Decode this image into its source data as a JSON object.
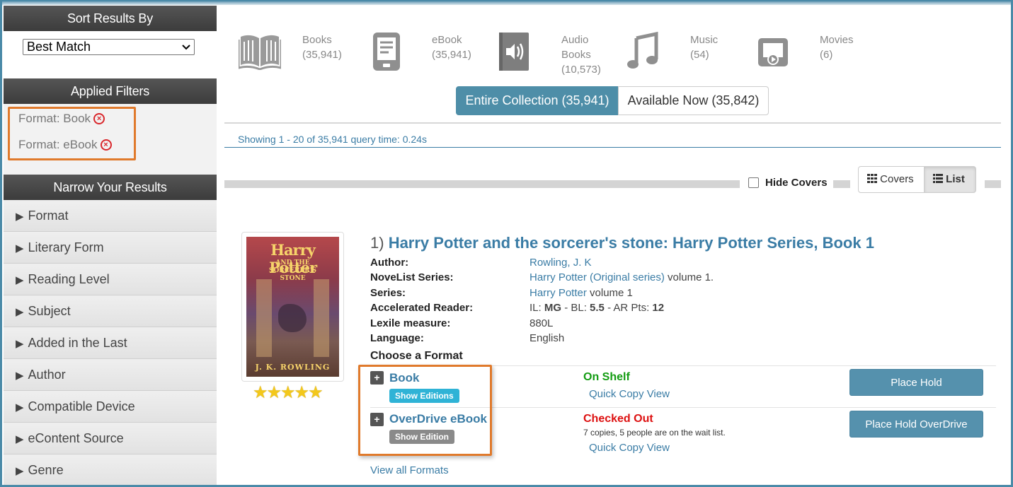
{
  "sidebar": {
    "sort_header": "Sort Results By",
    "sort_value": "Best Match",
    "applied_header": "Applied Filters",
    "applied_filters": [
      "Format: Book",
      "Format: eBook"
    ],
    "narrow_header": "Narrow Your Results",
    "facets": [
      "Format",
      "Literary Form",
      "Reading Level",
      "Subject",
      "Added in the Last",
      "Author",
      "Compatible Device",
      "eContent Source",
      "Genre"
    ]
  },
  "formats": [
    {
      "icon": "book-icon",
      "label_line1": "Books",
      "label_line2": "(35,941)",
      "label_line3": ""
    },
    {
      "icon": "ebook-icon",
      "label_line1": "eBook",
      "label_line2": "(35,941)",
      "label_line3": ""
    },
    {
      "icon": "audiobook-icon",
      "label_line1": "Audio",
      "label_line2": "Books",
      "label_line3": "(10,573)"
    },
    {
      "icon": "music-icon",
      "label_line1": "Music",
      "label_line2": "(54)",
      "label_line3": ""
    },
    {
      "icon": "movie-icon",
      "label_line1": "Movies",
      "label_line2": "(6)",
      "label_line3": ""
    }
  ],
  "availability": {
    "entire": "Entire Collection (35,941)",
    "available": "Available Now (35,842)"
  },
  "showing_text": "Showing 1 - 20 of 35,941 query time: 0.24s",
  "view": {
    "hide_covers": "Hide Covers",
    "covers": "Covers",
    "list": "List"
  },
  "result": {
    "number": "1)",
    "title": "Harry Potter and the sorcerer's stone: Harry Potter Series, Book 1",
    "cover_title": "Harry Potter",
    "cover_subtitle": "AND THE SORCERER'S STONE",
    "cover_author": "J. K. ROWLING",
    "rating_stars": 5,
    "details": {
      "author_label": "Author:",
      "author_value": "Rowling, J. K",
      "novelist_label": "NoveList Series:",
      "novelist_link": "Harry Potter (Original series)",
      "novelist_rest": " volume 1.",
      "series_label": "Series:",
      "series_link": "Harry Potter",
      "series_rest": " volume 1",
      "ar_label": "Accelerated Reader:",
      "ar_il_label": "IL: ",
      "ar_il": "MG",
      "ar_bl_label": " - BL: ",
      "ar_bl": "5.5",
      "ar_pts_label": " - AR Pts: ",
      "ar_pts": "12",
      "lexile_label": "Lexile measure:",
      "lexile_value": "880L",
      "language_label": "Language:",
      "language_value": "English"
    },
    "choose_format": "Choose a Format",
    "format_rows": [
      {
        "name": "Book",
        "badge": "Show Editions",
        "status": "On Shelf",
        "note": "",
        "quick_copy": "Quick Copy View",
        "button": "Place Hold"
      },
      {
        "name": "OverDrive eBook",
        "badge": "Show Edition",
        "status": "Checked Out",
        "note": "7 copies, 5 people are on the wait list.",
        "quick_copy": "Quick Copy View",
        "button": "Place Hold OverDrive"
      }
    ],
    "view_all": "View all Formats"
  },
  "colors": {
    "accent": "#4e8ea8",
    "link": "#3a7ca5",
    "highlight": "#e07a2c",
    "on_shelf": "#139c12",
    "checked_out": "#dd1111"
  }
}
